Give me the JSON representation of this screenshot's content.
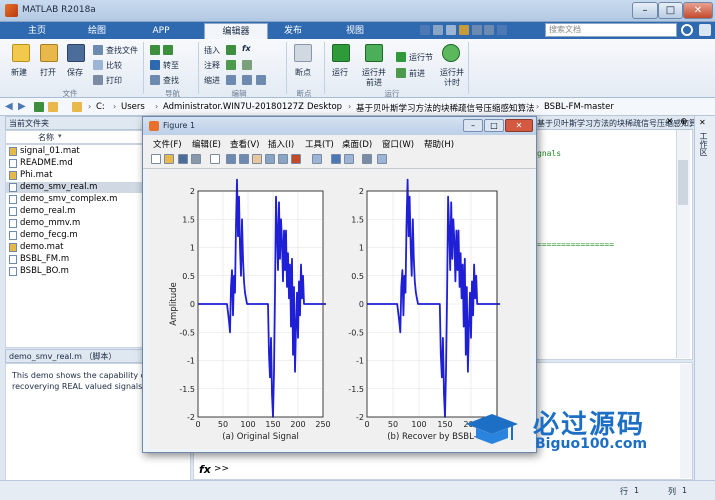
{
  "window": {
    "title": "MATLAB R2018a",
    "minimize": "–",
    "maximize": "□",
    "close": "✕"
  },
  "tabs": [
    {
      "label": "主页"
    },
    {
      "label": "绘图"
    },
    {
      "label": "APP"
    },
    {
      "label": "编辑器"
    },
    {
      "label": "发布"
    },
    {
      "label": "视图"
    }
  ],
  "search": {
    "placeholder": "搜索文档"
  },
  "ribbon": {
    "file": {
      "group": "文件",
      "new": "新建",
      "open": "打开",
      "save": "保存",
      "find_files": "查找文件",
      "compare": "比较",
      "print": "打印"
    },
    "navigate": {
      "group": "导航",
      "goto": "转至",
      "find": "查找"
    },
    "edit": {
      "group": "编辑",
      "insert": "插入",
      "comment": "注释",
      "indent": "缩进",
      "fx": "fx"
    },
    "breakpoints": {
      "group": "断点",
      "label": "断点"
    },
    "run": {
      "group": "运行",
      "run": "运行",
      "run_advance_1": "运行并",
      "run_advance_2": "前进",
      "run_section": "运行节",
      "advance": "前进",
      "run_time_1": "运行并",
      "run_time_2": "计时"
    }
  },
  "address": {
    "crumbs": [
      "C:",
      "Users",
      "Administrator.WIN7U-20180127Z",
      "Desktop",
      "基于贝叶斯学习方法的块稀疏信号压缩感知算法",
      "BSBL-FM-master"
    ]
  },
  "left_panel": {
    "header": "当前文件夹",
    "name_col": "名称",
    "files": [
      "signal_01.mat",
      "README.md",
      "Phi.mat",
      "demo_smv_real.m",
      "demo_smv_complex.m",
      "demo_real.m",
      "demo_mmv.m",
      "demo_fecg.m",
      "demo.mat",
      "BSBL_FM.m",
      "BSBL_BO.m"
    ],
    "detail_header": "demo_smv_real.m （脚本）",
    "detail_line1": "This demo shows the capability of",
    "detail_line2": "recoverying REAL valued signals"
  },
  "editor": {
    "tab_title": "基于贝叶斯学习方法的块稀疏信号压缩感知算法\\BSBL...",
    "code_fragment": "gnals",
    "code_rule": "================"
  },
  "right_bar": {
    "label": "工作区"
  },
  "command_window": {
    "fx": "fx",
    "prompt": ">>"
  },
  "status": {
    "row_label": "行",
    "row_value": "1",
    "col_label": "列",
    "col_value": "1"
  },
  "watermark": {
    "title": "必过源码",
    "url": "Biguo100.com"
  },
  "figure": {
    "title": "Figure 1",
    "menu": [
      "文件(F)",
      "编辑(E)",
      "查看(V)",
      "插入(I)",
      "工具(T)",
      "桌面(D)",
      "窗口(W)",
      "帮助(H)"
    ]
  },
  "chart_data": [
    {
      "type": "line",
      "title": "",
      "xlabel": "(a) Original Signal",
      "ylabel": "Amplitude",
      "xlim": [
        0,
        250
      ],
      "ylim": [
        -2,
        2
      ],
      "xticks": [
        0,
        50,
        100,
        150,
        200,
        250
      ],
      "yticks": [
        -2,
        -1.5,
        -1,
        -0.5,
        0,
        0.5,
        1,
        1.5,
        2
      ],
      "grid": true,
      "color": "#1f1fd6",
      "x": [
        0,
        58,
        62,
        64,
        66,
        68,
        70,
        72,
        74,
        76,
        78,
        80,
        82,
        84,
        86,
        88,
        90,
        92,
        94,
        96,
        98,
        100,
        140,
        142,
        144,
        146,
        148,
        150,
        152,
        154,
        156,
        158,
        160,
        162,
        164,
        166,
        168,
        170,
        172,
        174,
        176,
        178,
        180,
        182,
        184,
        186,
        188,
        190,
        192,
        194,
        196,
        198,
        200,
        202,
        204,
        206,
        208,
        210,
        212,
        256
      ],
      "y": [
        0,
        0,
        -0.3,
        -0.5,
        0.3,
        0.6,
        -0.2,
        0.5,
        0.2,
        1.4,
        2.2,
        1.2,
        1.9,
        1.0,
        0.5,
        1.5,
        0.8,
        0.4,
        0.2,
        0.1,
        0,
        0,
        0,
        -0.9,
        -1.3,
        -0.6,
        -1.6,
        -2.0,
        -1.2,
        0.2,
        1.9,
        1.3,
        0.6,
        1.8,
        0.8,
        1.5,
        1.1,
        0.4,
        1.3,
        0.6,
        1.3,
        0.3,
        0.9,
        0.1,
        0.7,
        -0.4,
        0.8,
        -0.9,
        0.3,
        -1.2,
        -0.4,
        0.2,
        -0.6,
        0.4,
        -0.2,
        0.7,
        0.1,
        0.5,
        0,
        0
      ]
    },
    {
      "type": "line",
      "title": "",
      "xlabel": "(b) Recover by BSBL-",
      "ylabel": "",
      "xlim": [
        0,
        250
      ],
      "ylim": [
        -2,
        2
      ],
      "xticks": [
        0,
        50,
        100,
        150,
        200
      ],
      "yticks": [
        -2,
        -1.5,
        -1,
        -0.5,
        0,
        0.5,
        1,
        1.5,
        2
      ],
      "grid": true,
      "color": "#1f1fd6",
      "x": [
        0,
        58,
        62,
        64,
        66,
        68,
        70,
        72,
        74,
        76,
        78,
        80,
        82,
        84,
        86,
        88,
        90,
        92,
        94,
        96,
        98,
        100,
        140,
        142,
        144,
        146,
        148,
        150,
        152,
        154,
        156,
        158,
        160,
        162,
        164,
        166,
        168,
        170,
        172,
        174,
        176,
        178,
        180,
        182,
        184,
        186,
        188,
        190,
        192,
        194,
        196,
        198,
        200,
        202,
        204,
        206,
        208,
        210,
        212,
        256
      ],
      "y": [
        0,
        0,
        -0.3,
        -0.5,
        0.3,
        0.6,
        -0.2,
        0.5,
        0.2,
        1.4,
        2.2,
        1.2,
        1.9,
        1.0,
        0.5,
        1.5,
        0.8,
        0.4,
        0.2,
        0.1,
        0,
        0,
        0,
        -0.9,
        -1.3,
        -0.6,
        -1.6,
        -2.0,
        -1.2,
        0.2,
        1.9,
        1.3,
        0.6,
        1.8,
        0.8,
        1.5,
        1.1,
        0.4,
        1.3,
        0.6,
        1.3,
        0.3,
        0.9,
        0.1,
        0.7,
        -0.4,
        0.8,
        -0.9,
        0.3,
        -1.2,
        -0.4,
        0.2,
        -0.6,
        0.4,
        -0.2,
        0.7,
        0.1,
        0.5,
        0,
        0
      ]
    }
  ]
}
